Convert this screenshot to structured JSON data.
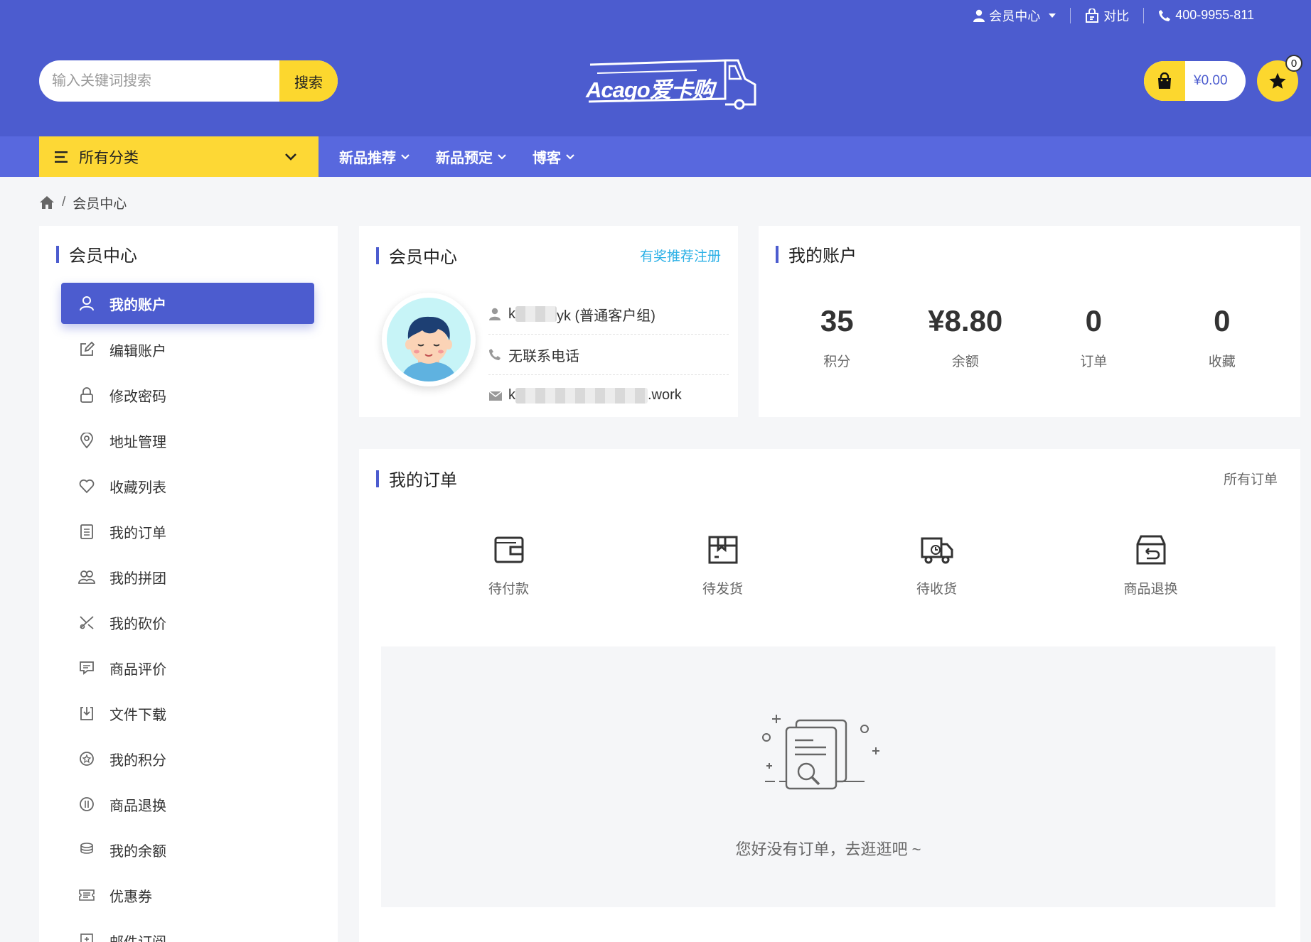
{
  "topbar": {
    "member_center": "会员中心",
    "compare": "对比",
    "phone": "400-9955-811"
  },
  "header": {
    "search_placeholder": "输入关键词搜索",
    "search_button": "搜索",
    "logo_text": "Acago爱卡购",
    "cart_amount": "¥0.00",
    "favorites_count": "0"
  },
  "nav": {
    "all_categories": "所有分类",
    "items": [
      "新品推荐",
      "新品预定",
      "博客"
    ]
  },
  "breadcrumb": {
    "current": "会员中心",
    "separator": "/"
  },
  "sidebar": {
    "title": "会员中心",
    "items": [
      {
        "label": "我的账户",
        "icon": "user-icon",
        "active": true
      },
      {
        "label": "编辑账户",
        "icon": "edit-icon"
      },
      {
        "label": "修改密码",
        "icon": "lock-icon"
      },
      {
        "label": "地址管理",
        "icon": "location-icon"
      },
      {
        "label": "收藏列表",
        "icon": "heart-icon"
      },
      {
        "label": "我的订单",
        "icon": "clipboard-icon"
      },
      {
        "label": "我的拼团",
        "icon": "group-icon"
      },
      {
        "label": "我的砍价",
        "icon": "bargain-icon"
      },
      {
        "label": "商品评价",
        "icon": "comment-icon"
      },
      {
        "label": "文件下载",
        "icon": "download-icon"
      },
      {
        "label": "我的积分",
        "icon": "points-icon"
      },
      {
        "label": "商品退换",
        "icon": "return-icon"
      },
      {
        "label": "我的余额",
        "icon": "coins-icon"
      },
      {
        "label": "优惠券",
        "icon": "coupon-icon"
      },
      {
        "label": "邮件订阅",
        "icon": "mail-subscribe-icon"
      }
    ]
  },
  "member": {
    "title": "会员中心",
    "invite_link": "有奖推荐注册",
    "name_suffix": "yk (普通客户组)",
    "name_prefix": "k",
    "phone": "无联系电话",
    "email_prefix": "k",
    "email_suffix": ".work"
  },
  "account": {
    "title": "我的账户",
    "stats": [
      {
        "value": "35",
        "label": "积分"
      },
      {
        "value": "¥8.80",
        "label": "余额"
      },
      {
        "value": "0",
        "label": "订单"
      },
      {
        "value": "0",
        "label": "收藏"
      }
    ]
  },
  "orders": {
    "title": "我的订单",
    "all_orders": "所有订单",
    "types": [
      {
        "label": "待付款",
        "icon": "wallet-icon"
      },
      {
        "label": "待发货",
        "icon": "package-icon"
      },
      {
        "label": "待收货",
        "icon": "truck-icon"
      },
      {
        "label": "商品退换",
        "icon": "return-box-icon"
      }
    ],
    "empty_message": "您好没有订单，去逛逛吧 ~"
  },
  "colors": {
    "primary": "#4c5ccf",
    "nav": "#5868de",
    "accent": "#fdd835",
    "link": "#2bb0e6"
  }
}
